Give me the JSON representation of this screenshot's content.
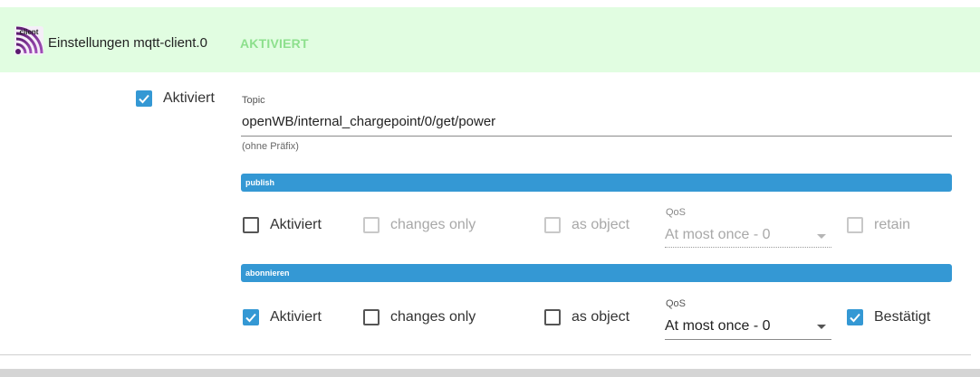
{
  "header": {
    "logo_text": "client",
    "title": "Einstellungen mqtt-client.0",
    "status": "AKTIVIERT"
  },
  "main": {
    "enabled_label": "Aktiviert",
    "enabled_checked": true,
    "topic": {
      "label": "Topic",
      "value": "openWB/internal_chargepoint/0/get/power",
      "hint": "(ohne Präfix)"
    }
  },
  "publish": {
    "section_title": "publish",
    "enabled": {
      "label": "Aktiviert",
      "checked": false
    },
    "changes_only": {
      "label": "changes only",
      "checked": false,
      "disabled": true
    },
    "as_object": {
      "label": "as object",
      "checked": false,
      "disabled": true
    },
    "qos": {
      "label": "QoS",
      "value": "At most once - 0",
      "disabled": true
    },
    "retain": {
      "label": "retain",
      "checked": false,
      "disabled": true
    }
  },
  "subscribe": {
    "section_title": "abonnieren",
    "enabled": {
      "label": "Aktiviert",
      "checked": true
    },
    "changes_only": {
      "label": "changes only",
      "checked": false
    },
    "as_object": {
      "label": "as object",
      "checked": false
    },
    "qos": {
      "label": "QoS",
      "value": "At most once - 0"
    },
    "ack": {
      "label": "Bestätigt",
      "checked": true
    }
  },
  "colors": {
    "accent": "#3498d4",
    "header_bg": "#e1fde1",
    "status_green": "#8de08d"
  }
}
